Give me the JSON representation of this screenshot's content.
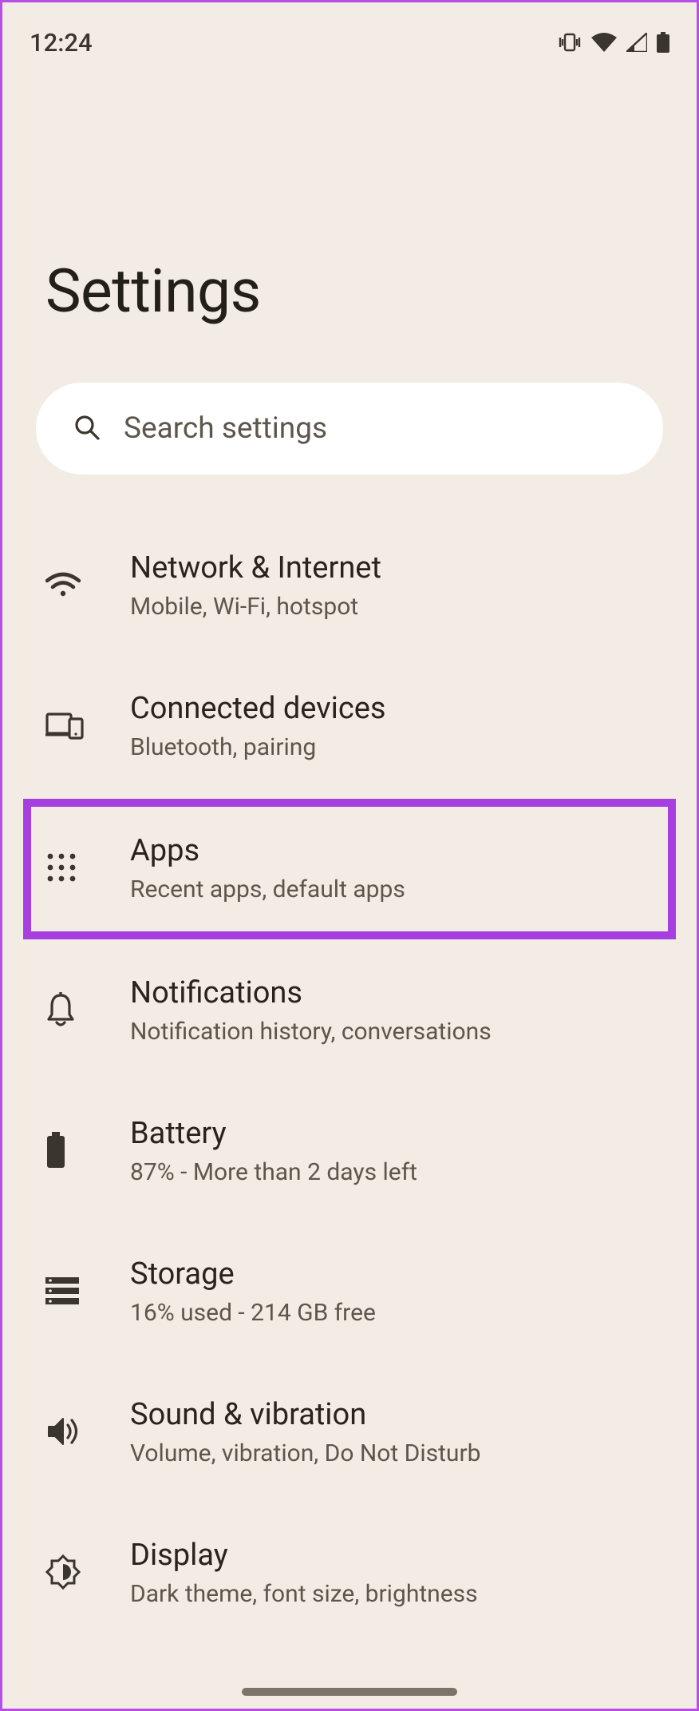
{
  "status": {
    "time": "12:24"
  },
  "page": {
    "title": "Settings"
  },
  "search": {
    "placeholder": "Search settings"
  },
  "items": [
    {
      "title": "Network & Internet",
      "sub": "Mobile, Wi-Fi, hotspot"
    },
    {
      "title": "Connected devices",
      "sub": "Bluetooth, pairing"
    },
    {
      "title": "Apps",
      "sub": "Recent apps, default apps",
      "highlighted": true
    },
    {
      "title": "Notifications",
      "sub": "Notification history, conversations"
    },
    {
      "title": "Battery",
      "sub": "87% - More than 2 days left"
    },
    {
      "title": "Storage",
      "sub": "16% used - 214 GB free"
    },
    {
      "title": "Sound & vibration",
      "sub": "Volume, vibration, Do Not Disturb"
    },
    {
      "title": "Display",
      "sub": "Dark theme, font size, brightness"
    }
  ]
}
